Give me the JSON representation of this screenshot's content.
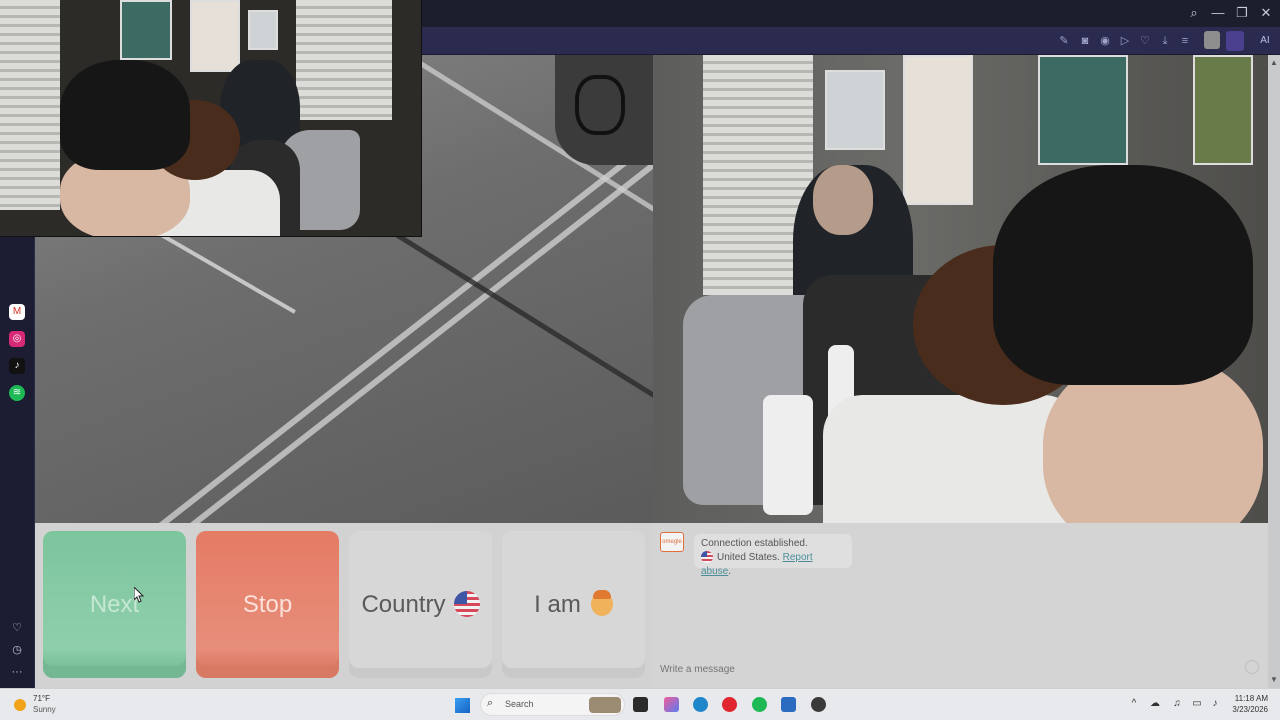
{
  "browser": {
    "ai_label": "AI",
    "titlebar_controls": {
      "search": "⌕",
      "minimize": "—",
      "restore": "❐",
      "close": "✕"
    },
    "toolbar_icons": [
      "edit-icon",
      "camera-icon",
      "vpn-icon",
      "play-icon",
      "heart-icon",
      "download-icon",
      "menu-icon"
    ]
  },
  "sidebar": {
    "apps": [
      {
        "name": "gmail",
        "glyph": "M",
        "color": "#d93025"
      },
      {
        "name": "instagram",
        "glyph": "◎",
        "color": "#d62976"
      },
      {
        "name": "tiktok",
        "glyph": "♪",
        "color": "#111111"
      },
      {
        "name": "spotify",
        "glyph": "≋",
        "color": "#1db954"
      }
    ],
    "bottom": {
      "heart": "♡",
      "history": "◷",
      "more": "···"
    }
  },
  "controls": {
    "next_label": "Next",
    "stop_label": "Stop",
    "country_label": "Country",
    "iam_label": "I am",
    "colors": {
      "next": "#7cc59d",
      "stop": "#e57b64"
    }
  },
  "chat": {
    "logo_text": "omegle",
    "status_line": "Connection established.",
    "country_text": "United States.",
    "report_link": "Report abuse",
    "report_suffix": ".",
    "input_placeholder": "Write a message"
  },
  "taskbar": {
    "weather_temp": "71°F",
    "weather_desc": "Sunny",
    "search_placeholder": "Search",
    "time": "11:18 AM",
    "date": "3/23/2026"
  }
}
